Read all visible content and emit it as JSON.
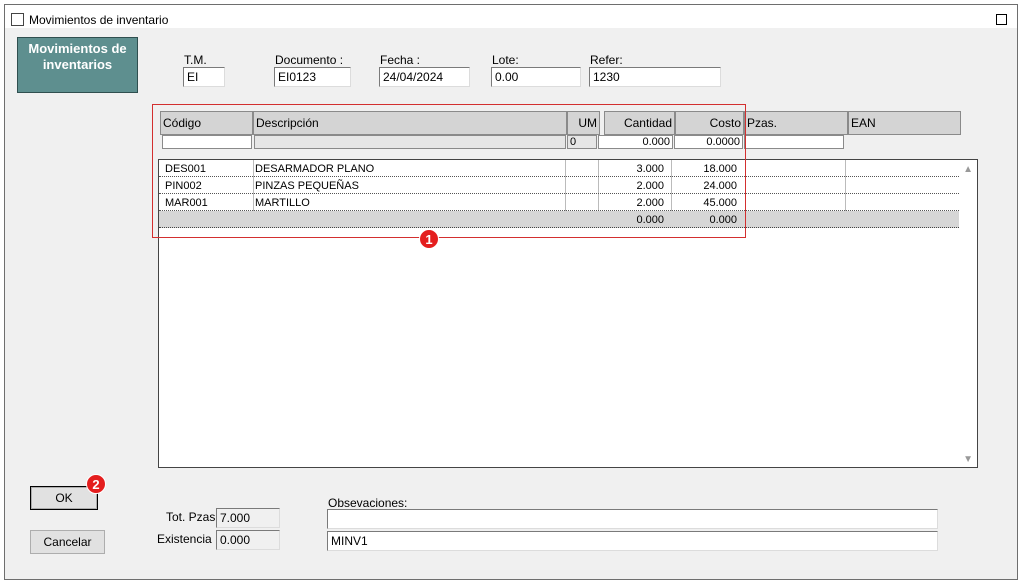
{
  "window": {
    "title": "Movimientos de inventario"
  },
  "brand": {
    "line1": "Movimientos de",
    "line2": "inventarios"
  },
  "header": {
    "tm_label": "T.M.",
    "tm_value": "EI",
    "documento_label": "Documento :",
    "documento_value": "EI0123",
    "fecha_label": "Fecha :",
    "fecha_value": "24/04/2024",
    "lote_label": "Lote:",
    "lote_value": "0.00",
    "refer_label": "Refer:",
    "refer_value": "1230"
  },
  "grid": {
    "columns": [
      "Código",
      "Descripción",
      "UM",
      "Cantidad",
      "Costo",
      "Pzas.",
      "EAN"
    ],
    "input_row": {
      "codigo": "",
      "descripcion": "",
      "um": "0",
      "cantidad": "0.000",
      "costo": "0.0000",
      "pzas": ""
    },
    "rows": [
      {
        "codigo": "DES001",
        "descripcion": "DESARMADOR PLANO",
        "cantidad": "3.000",
        "costo": "18.000"
      },
      {
        "codigo": "PIN002",
        "descripcion": "PINZAS PEQUEÑAS",
        "cantidad": "2.000",
        "costo": "24.000"
      },
      {
        "codigo": "MAR001",
        "descripcion": "MARTILLO",
        "cantidad": "2.000",
        "costo": "45.000"
      }
    ],
    "totals": {
      "cantidad": "0.000",
      "costo": "0.000"
    }
  },
  "badges": {
    "b1": "1",
    "b2": "2"
  },
  "buttons": {
    "ok": "OK",
    "cancel": "Cancelar"
  },
  "footer": {
    "tot_pzas_label": "Tot. Pzas.",
    "tot_pzas_value": "7.000",
    "existencia_label": "Existencia :",
    "existencia_value": "0.000",
    "obs_label": "Obsevaciones:",
    "obs_value1": "",
    "obs_value2": "MINV1"
  },
  "colors": {
    "brand": "#5e8f8f",
    "highlight": "#e41e1e"
  }
}
